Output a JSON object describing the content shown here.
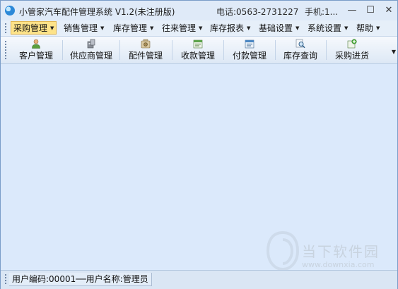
{
  "window": {
    "title": "小管家汽车配件管理系统 V1.2(未注册版)",
    "phone": "电话:0563-2731227",
    "mobile": "手机:1...",
    "controls": {
      "minimize": "—",
      "maximize": "☐",
      "close": "✕"
    }
  },
  "menu": {
    "items": [
      {
        "label": "采购管理",
        "active": true
      },
      {
        "label": "销售管理"
      },
      {
        "label": "库存管理"
      },
      {
        "label": "往来管理"
      },
      {
        "label": "库存报表"
      },
      {
        "label": "基础设置"
      },
      {
        "label": "系统设置"
      },
      {
        "label": "帮助"
      }
    ]
  },
  "toolbar": {
    "buttons": [
      {
        "label": "客户管理",
        "icon": "customer-icon"
      },
      {
        "label": "供应商管理",
        "icon": "supplier-icon"
      },
      {
        "label": "配件管理",
        "icon": "parts-icon"
      },
      {
        "label": "收款管理",
        "icon": "receipt-icon"
      },
      {
        "label": "付款管理",
        "icon": "payment-icon"
      },
      {
        "label": "库存查询",
        "icon": "inventory-search-icon"
      },
      {
        "label": "采购进货",
        "icon": "purchase-icon"
      }
    ]
  },
  "status": {
    "text": "用户编码:00001──用户名称:管理员"
  },
  "watermark": {
    "name": "当下软件园",
    "url": "www.downxia.com"
  },
  "colors": {
    "background": "#dbe9fb",
    "menu_active": "#fde389"
  }
}
